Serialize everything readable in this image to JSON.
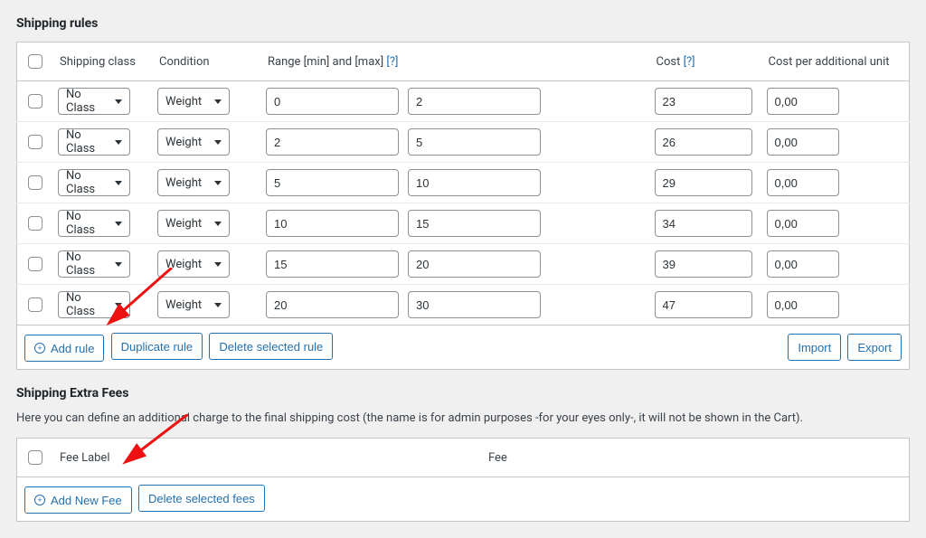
{
  "sections": {
    "rules_title": "Shipping rules",
    "fees_title": "Shipping Extra Fees",
    "fees_desc": "Here you can define an additional charge to the final shipping cost (the name is for admin purposes -for your eyes only-, it will not be shown in the Cart)."
  },
  "rules_table": {
    "headers": {
      "class": "Shipping class",
      "condition": "Condition",
      "range": "Range [min] and [max]",
      "range_help": "[?]",
      "cost": "Cost",
      "cost_help": "[?]",
      "additional": "Cost per additional unit"
    },
    "rows": [
      {
        "class": "No Class",
        "condition": "Weight",
        "min": "0",
        "max": "2",
        "cost": "23",
        "addl": "0,00"
      },
      {
        "class": "No Class",
        "condition": "Weight",
        "min": "2",
        "max": "5",
        "cost": "26",
        "addl": "0,00"
      },
      {
        "class": "No Class",
        "condition": "Weight",
        "min": "5",
        "max": "10",
        "cost": "29",
        "addl": "0,00"
      },
      {
        "class": "No Class",
        "condition": "Weight",
        "min": "10",
        "max": "15",
        "cost": "34",
        "addl": "0,00"
      },
      {
        "class": "No Class",
        "condition": "Weight",
        "min": "15",
        "max": "20",
        "cost": "39",
        "addl": "0,00"
      },
      {
        "class": "No Class",
        "condition": "Weight",
        "min": "20",
        "max": "30",
        "cost": "47",
        "addl": "0,00"
      }
    ],
    "buttons": {
      "add": "Add rule",
      "duplicate": "Duplicate rule",
      "delete": "Delete selected rule",
      "import": "Import",
      "export": "Export"
    }
  },
  "fees_table": {
    "headers": {
      "label": "Fee Label",
      "fee": "Fee"
    },
    "buttons": {
      "add": "Add New Fee",
      "delete": "Delete selected fees"
    }
  }
}
